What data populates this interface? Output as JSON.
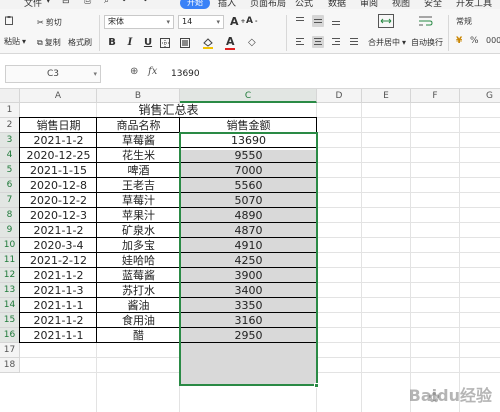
{
  "menu": {
    "file": "文件",
    "tabs": [
      "开始",
      "插入",
      "页面布局",
      "公式",
      "数据",
      "审阅",
      "视图",
      "安全",
      "开发工具"
    ]
  },
  "ribbon": {
    "cut": "剪切",
    "paste": "粘贴",
    "copy": "复制",
    "format_painter": "格式刷",
    "font_name": "宋体",
    "font_size": "14",
    "bold": "B",
    "italic": "I",
    "underline": "U",
    "merge_center": "合并居中",
    "wrap_text": "自动换行",
    "number_format": "常规"
  },
  "formula_bar": {
    "name_box": "C3",
    "fx": "fx",
    "value": "13690"
  },
  "columns": [
    "A",
    "B",
    "C",
    "D",
    "E",
    "F",
    "G"
  ],
  "rows": [
    "1",
    "2",
    "3",
    "4",
    "5",
    "6",
    "7",
    "8",
    "9",
    "10",
    "11",
    "12",
    "13",
    "14",
    "15",
    "16",
    "17",
    "18"
  ],
  "sheet": {
    "title": "销售汇总表",
    "headers": [
      "销售日期",
      "商品名称",
      "销售金额"
    ],
    "data": [
      [
        "2021-1-2",
        "草莓酱",
        "13690"
      ],
      [
        "2020-12-25",
        "花生米",
        "9550"
      ],
      [
        "2021-1-15",
        "啤酒",
        "7000"
      ],
      [
        "2020-12-8",
        "王老吉",
        "5560"
      ],
      [
        "2020-12-2",
        "草莓汁",
        "5070"
      ],
      [
        "2020-12-3",
        "苹果汁",
        "4890"
      ],
      [
        "2021-1-2",
        "矿泉水",
        "4870"
      ],
      [
        "2020-3-4",
        "加多宝",
        "4910"
      ],
      [
        "2021-2-12",
        "娃哈哈",
        "4250"
      ],
      [
        "2021-1-2",
        "蓝莓酱",
        "3900"
      ],
      [
        "2021-1-3",
        "苏打水",
        "3400"
      ],
      [
        "2021-1-1",
        "酱油",
        "3350"
      ],
      [
        "2021-1-2",
        "食用油",
        "3160"
      ],
      [
        "2021-1-1",
        "醋",
        "2950"
      ]
    ]
  },
  "watermark": "Baidu经验"
}
